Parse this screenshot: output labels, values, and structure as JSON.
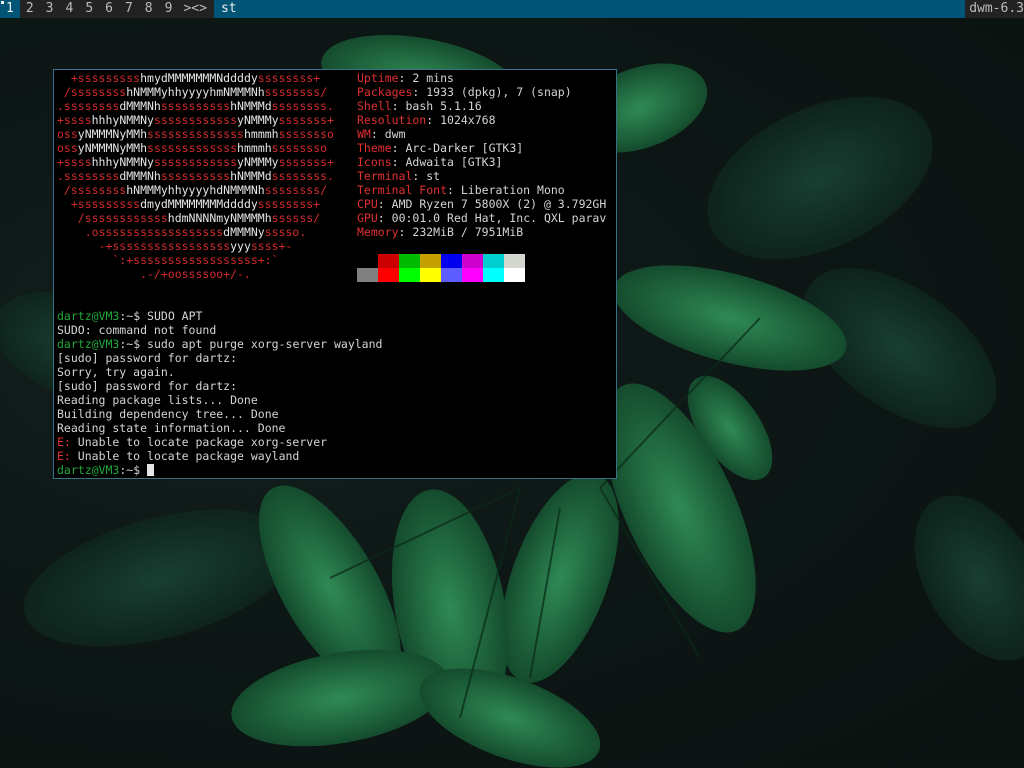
{
  "bar": {
    "tags": [
      "1",
      "2",
      "3",
      "4",
      "5",
      "6",
      "7",
      "8",
      "9"
    ],
    "active_tag": "1",
    "layout_symbol": "><>",
    "window_title": "st",
    "status": "dwm-6.3"
  },
  "colors": {
    "bar_bg": "#222222",
    "bar_selected": "#005577",
    "term_border": "#3b6f83",
    "accent_red": "#e03030",
    "prompt_green": "#21a83a"
  },
  "neofetch": {
    "logo_lines": [
      "  +ssssssssshmydMMMMMMMNddddyssssssss+",
      " /sssssssshNMMMyhhyyyyhmNMMMNhssssssss/",
      ".ssssssssdMMMNhsssssssssshNMMMdssssssss.",
      "+sssshhhyNMMNyssssssssssssyNMMMysssssss+",
      "ossyNMMMNyMMhsssssssssssssshmmmhssssssso",
      "ossyNMMMNyMMhssssssssssssshmmmhssssssso",
      "+sssshhhyNMMNyssssssssssssyNMMMysssssss+",
      ".ssssssssdMMMNhsssssssssshNMMMdssssssss.",
      " /sssssssshNMMMyhhyyyyhdNMMMNhssssssss/",
      "  +sssssssssdmydMMMMMMMMddddyssssssss+",
      "   /sssssssssssshdmNNNNmyNMMMMhssssss/",
      "    .ossssssssssssssssssdMMMNysssso.",
      "      -+sssssssssssssssssyyyssss+-",
      "        `:+ssssssssssssssssss+:`",
      "            .-/+oossssoo+/-."
    ],
    "info": [
      {
        "key": "Uptime",
        "value": "2 mins"
      },
      {
        "key": "Packages",
        "value": "1933 (dpkg), 7 (snap)"
      },
      {
        "key": "Shell",
        "value": "bash 5.1.16"
      },
      {
        "key": "Resolution",
        "value": "1024x768"
      },
      {
        "key": "WM",
        "value": "dwm"
      },
      {
        "key": "Theme",
        "value": "Arc-Darker [GTK3]"
      },
      {
        "key": "Icons",
        "value": "Adwaita [GTK3]"
      },
      {
        "key": "Terminal",
        "value": "st"
      },
      {
        "key": "Terminal Font",
        "value": "Liberation Mono"
      },
      {
        "key": "CPU",
        "value": "AMD Ryzen 7 5800X (2) @ 3.792GH"
      },
      {
        "key": "GPU",
        "value": "00:01.0 Red Hat, Inc. QXL parav"
      },
      {
        "key": "Memory",
        "value": "232MiB / 7951MiB"
      }
    ],
    "palette_dark": [
      "#000000",
      "#cc0000",
      "#00bb00",
      "#c4a000",
      "#0000ee",
      "#cd00cd",
      "#00cdcd",
      "#d3d7cf"
    ],
    "palette_bright": [
      "#808080",
      "#ff0000",
      "#00ff00",
      "#ffff00",
      "#5c5cff",
      "#ff00ff",
      "#00ffff",
      "#ffffff"
    ]
  },
  "shell": {
    "lines": [
      {
        "user": "dartz@VM3",
        "path": "~",
        "cmd": "SUDO APT"
      },
      {
        "text": "SUDO: command not found"
      },
      {
        "user": "dartz@VM3",
        "path": "~",
        "cmd": "sudo apt purge xorg-server wayland"
      },
      {
        "text": "[sudo] password for dartz:"
      },
      {
        "text": "Sorry, try again."
      },
      {
        "text": "[sudo] password for dartz:"
      },
      {
        "text": "Reading package lists... Done"
      },
      {
        "text": "Building dependency tree... Done"
      },
      {
        "text": "Reading state information... Done"
      },
      {
        "err": "E:",
        "text": "Unable to locate package xorg-server"
      },
      {
        "err": "E:",
        "text": "Unable to locate package wayland"
      },
      {
        "user": "dartz@VM3",
        "path": "~",
        "cmd": "",
        "cursor": true
      }
    ]
  }
}
